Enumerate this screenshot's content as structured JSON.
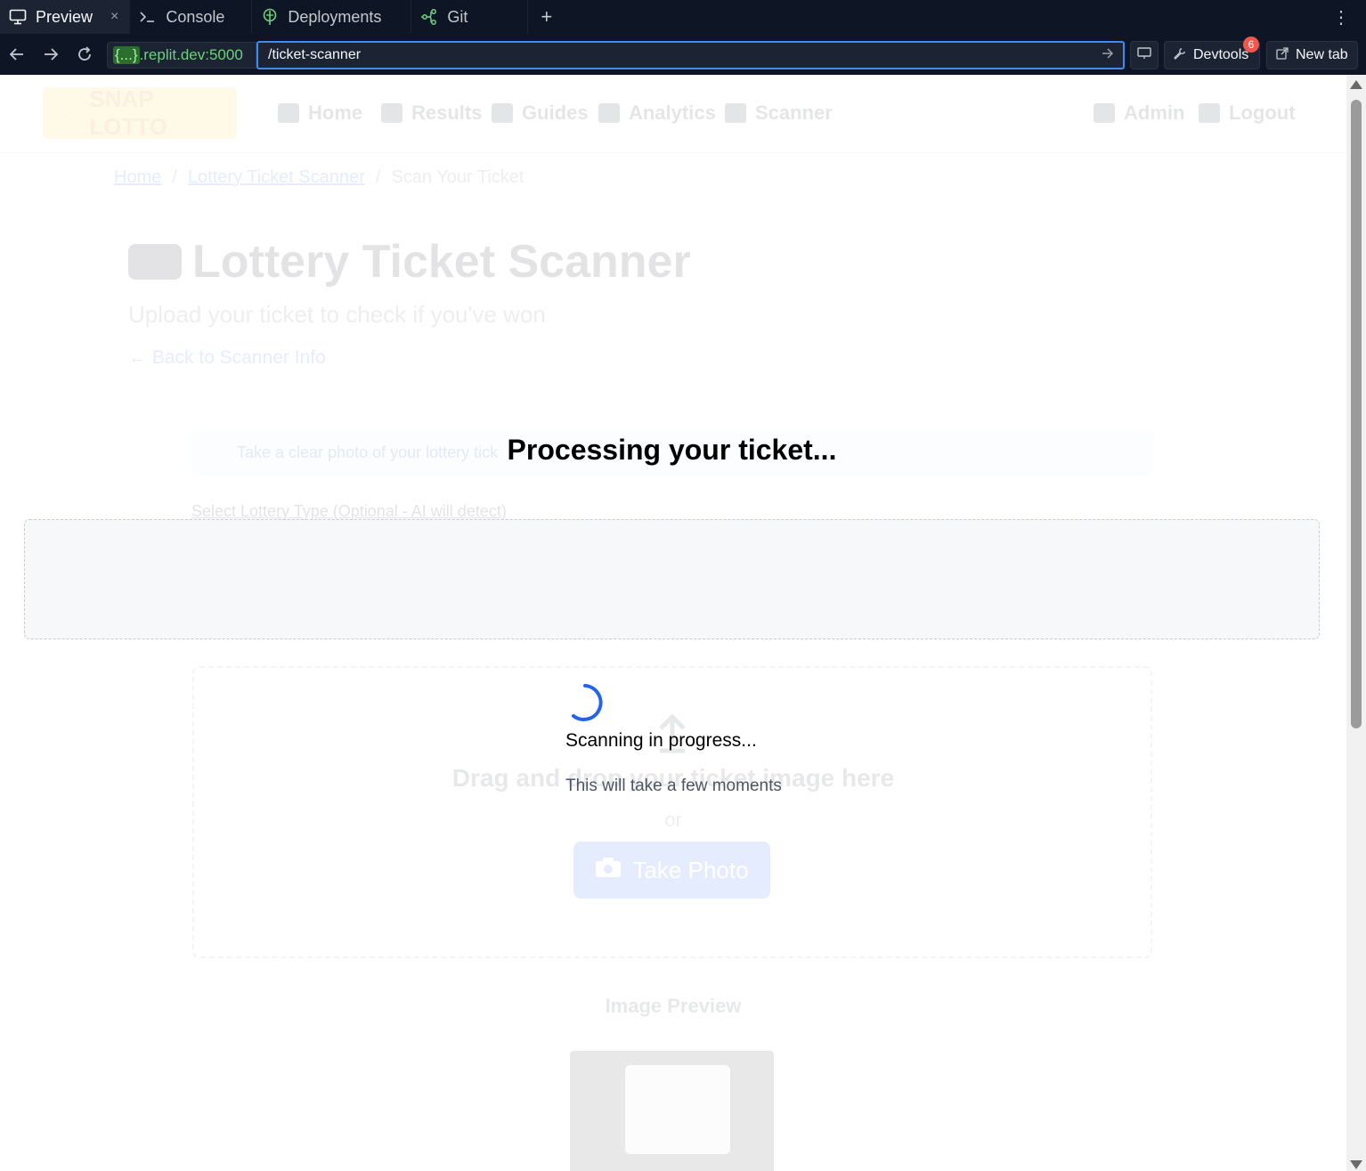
{
  "tabs": [
    {
      "label": "Preview",
      "icon": "monitor-icon",
      "active": true
    },
    {
      "label": "Console",
      "icon": "terminal-icon",
      "active": false
    },
    {
      "label": "Deployments",
      "icon": "deployments-icon",
      "active": false
    },
    {
      "label": "Git",
      "icon": "git-icon",
      "active": false
    }
  ],
  "tab_close_glyph": "×",
  "tab_add_glyph": "+",
  "tab_more_glyph": "⋮",
  "url": {
    "host_braces": "{...}",
    "host": ".replit.dev:5000",
    "path": "/ticket-scanner"
  },
  "toolbar": {
    "devtools_label": "Devtools",
    "devtools_badge": "6",
    "newtab_label": "New tab"
  },
  "site": {
    "logo": "SNAP LOTTO",
    "nav": [
      "Home",
      "Results",
      "Guides",
      "Analytics",
      "Scanner"
    ],
    "admin": "Admin",
    "logout": "Logout"
  },
  "breadcrumb": {
    "home": "Home",
    "sep": "/",
    "scanner": "Lottery Ticket Scanner",
    "current": "Scan Your Ticket"
  },
  "page": {
    "title": "Lottery Ticket Scanner",
    "subtitle": "Upload your ticket to check if you've won",
    "back": "Back to Scanner Info",
    "info": "Take a clear photo of your lottery tick",
    "select_label": "Select Lottery Type (Optional - AI will detect)",
    "dropzone_text": "Drag and drop your ticket image here",
    "or": "or",
    "take_photo": "Take Photo",
    "preview_label": "Image Preview"
  },
  "overlay": {
    "title": "Processing your ticket...",
    "status": "Scanning in progress...",
    "sub": "This will take a few moments"
  },
  "colors": {
    "chrome_bg": "#0e1525",
    "accent": "#3d8cf0",
    "spinner": "#2563eb",
    "badge": "#f2564d"
  }
}
